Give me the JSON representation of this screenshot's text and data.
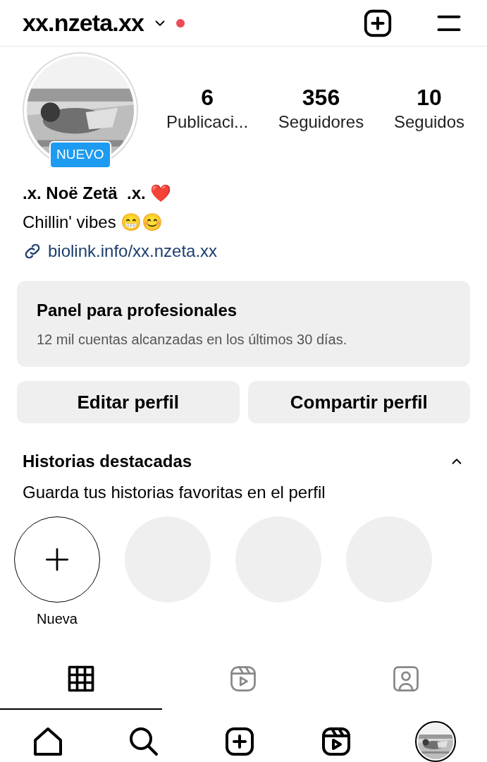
{
  "header": {
    "username": "xx.nzeta.xx",
    "unread": true
  },
  "profile": {
    "badge": "NUEVO",
    "stats": [
      {
        "value": "6",
        "label": "Publicaci..."
      },
      {
        "value": "356",
        "label": "Seguidores"
      },
      {
        "value": "10",
        "label": "Seguidos"
      }
    ],
    "name": ".x. Noë Zetä  .x. ❤️",
    "bio": "Chillin' vibes 😁😊",
    "link": "biolink.info/xx.nzeta.xx"
  },
  "dashboard": {
    "title": "Panel para profesionales",
    "subtitle": "12 mil cuentas alcanzadas en los últimos 30 días."
  },
  "buttons": [
    "Editar perfil",
    "Compartir perfil"
  ],
  "highlights": {
    "title": "Historias destacadas",
    "subtitle": "Guarda tus historias favoritas en el perfil",
    "expanded": true,
    "items": [
      {
        "kind": "new",
        "label": "Nueva"
      },
      {
        "kind": "empty"
      },
      {
        "kind": "empty"
      },
      {
        "kind": "empty"
      }
    ]
  },
  "tabs": [
    {
      "kind": "grid",
      "selected": true
    },
    {
      "kind": "reels",
      "selected": false
    },
    {
      "kind": "tagged",
      "selected": false
    }
  ],
  "bottom_nav": [
    {
      "kind": "home"
    },
    {
      "kind": "search"
    },
    {
      "kind": "create"
    },
    {
      "kind": "reels"
    },
    {
      "kind": "profile"
    }
  ]
}
